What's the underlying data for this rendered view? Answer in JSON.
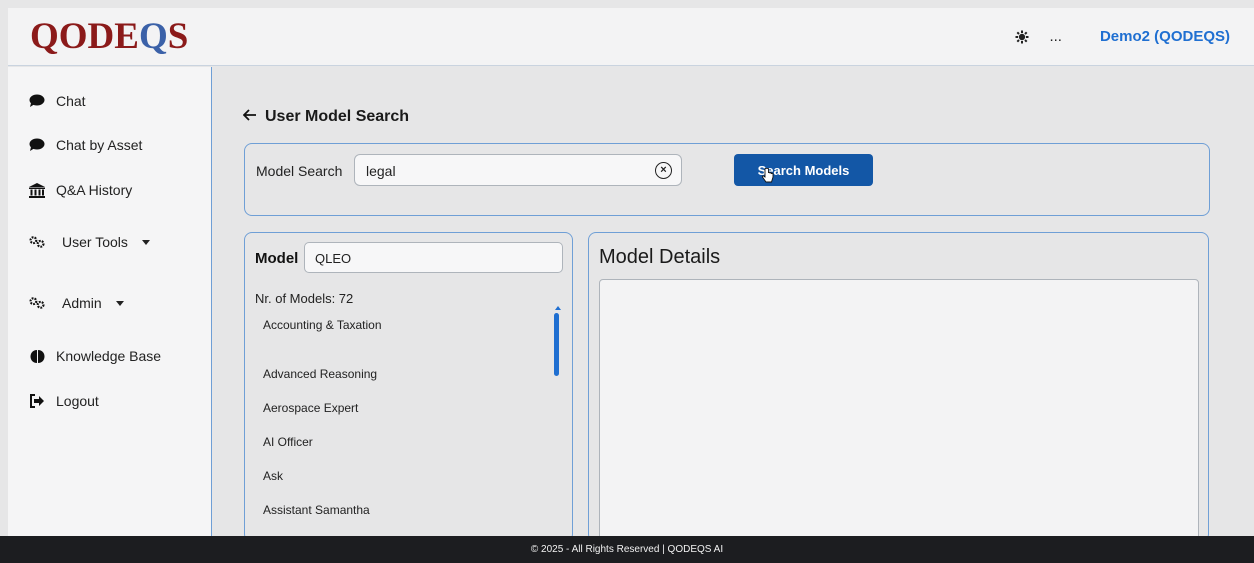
{
  "brand": {
    "logo_text_1": "Q",
    "logo_text_2": "ODE",
    "logo_text_3": "Q",
    "logo_text_4": "S"
  },
  "header": {
    "theme_more": "...",
    "user_label": "Demo2 (QODEQS)"
  },
  "sidebar": {
    "items": [
      {
        "label": "Chat",
        "icon": "chat-bubble-icon"
      },
      {
        "label": "Chat by Asset",
        "icon": "chat-bubble-icon"
      },
      {
        "label": "Q&A History",
        "icon": "bank-icon"
      },
      {
        "label": "User Tools",
        "icon": "gears-icon",
        "dropdown": true
      },
      {
        "label": "Admin",
        "icon": "gears-icon",
        "dropdown": true
      },
      {
        "label": "Knowledge Base",
        "icon": "brain-icon"
      },
      {
        "label": "Logout",
        "icon": "logout-icon"
      }
    ]
  },
  "main": {
    "title": "User Model Search",
    "search": {
      "label": "Model Search",
      "value": "legal",
      "button": "Search Models"
    },
    "model_list": {
      "label": "Model",
      "filter_value": "QLEO",
      "count_text": "Nr. of Models: 72",
      "items": [
        "Accounting & Taxation",
        "Advanced Reasoning",
        "Aerospace Expert",
        "AI Officer",
        "Ask",
        "Assistant Samantha"
      ]
    },
    "details": {
      "title": "Model Details"
    }
  },
  "footer": {
    "text": "© 2025 - All Rights Reserved | QODEQS AI"
  },
  "colors": {
    "accent": "#1357a6",
    "link": "#1f6fd1",
    "brand_red": "#8b1a1a",
    "brand_blue": "#3b61a8",
    "panel_border": "#6f9fd6",
    "footer_bg": "#1c1d20"
  }
}
